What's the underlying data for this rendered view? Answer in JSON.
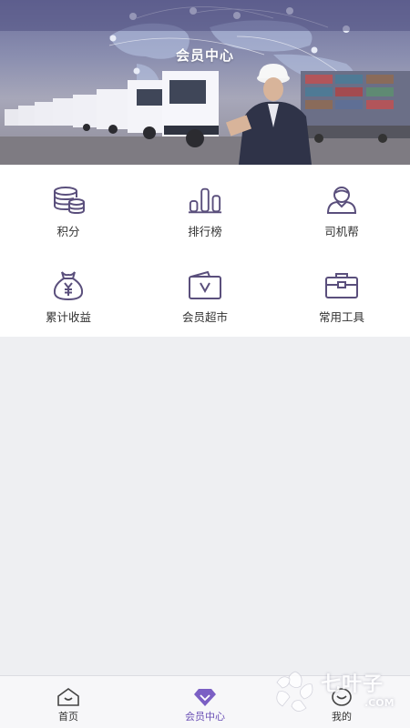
{
  "header": {
    "title": "会员中心"
  },
  "menu": [
    {
      "label": "积分",
      "icon": "coins-icon"
    },
    {
      "label": "排行榜",
      "icon": "bar-chart-icon"
    },
    {
      "label": "司机帮",
      "icon": "driver-icon"
    },
    {
      "label": "累计收益",
      "icon": "money-bag-icon"
    },
    {
      "label": "会员超市",
      "icon": "supermarket-icon"
    },
    {
      "label": "常用工具",
      "icon": "toolbox-icon"
    }
  ],
  "tabs": [
    {
      "label": "首页",
      "icon": "home-icon",
      "active": false
    },
    {
      "label": "会员中心",
      "icon": "diamond-icon",
      "active": true
    },
    {
      "label": "我的",
      "icon": "profile-icon",
      "active": false
    }
  ],
  "watermark": {
    "text": "七叶子",
    "domain": ".COM"
  },
  "colors": {
    "icon": "#5a4f7c",
    "accent": "#6a4fb5",
    "tab_bg": "#f7f7f9",
    "page_bg": "#eeeff2"
  }
}
